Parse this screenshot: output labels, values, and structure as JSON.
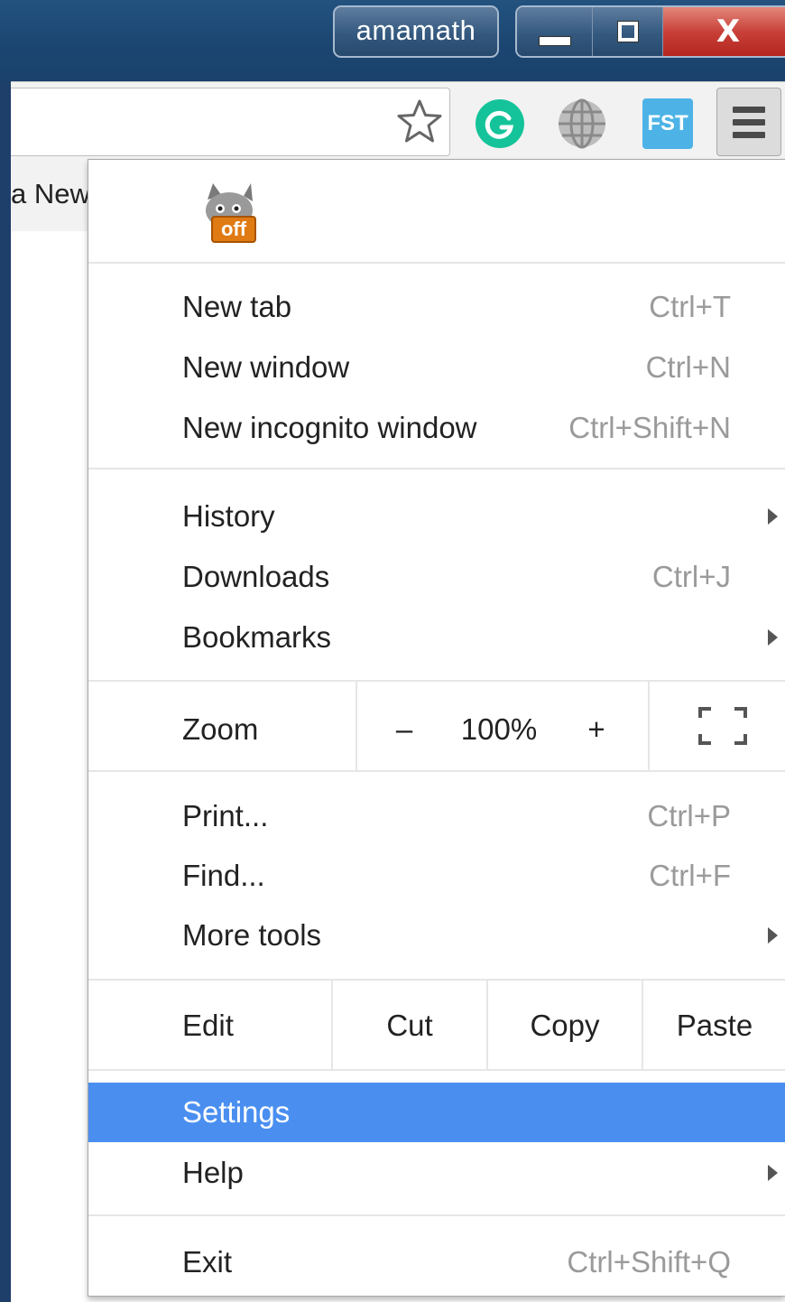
{
  "titlebar": {
    "user_label": "amamath",
    "minimize_icon": "minimize-icon",
    "maximize_icon": "restore-icon",
    "close_label": "X"
  },
  "toolbar": {
    "bookmark_icon": "star-icon",
    "extensions": [
      "grammarly-icon",
      "globe-icon",
      "fst-icon"
    ],
    "fst_label": "FST",
    "menu_icon": "hamburger-icon"
  },
  "page": {
    "tab_partial_text": "a New"
  },
  "menu": {
    "extension_badge": "off",
    "group1": [
      {
        "label": "New tab",
        "shortcut": "Ctrl+T"
      },
      {
        "label": "New window",
        "shortcut": "Ctrl+N"
      },
      {
        "label": "New incognito window",
        "shortcut": "Ctrl+Shift+N"
      }
    ],
    "group2": [
      {
        "label": "History",
        "shortcut": "",
        "submenu": true
      },
      {
        "label": "Downloads",
        "shortcut": "Ctrl+J"
      },
      {
        "label": "Bookmarks",
        "shortcut": "",
        "submenu": true
      }
    ],
    "zoom": {
      "label": "Zoom",
      "minus": "–",
      "value": "100%",
      "plus": "+",
      "fullscreen_icon": "fullscreen-icon"
    },
    "group3": [
      {
        "label": "Print...",
        "shortcut": "Ctrl+P"
      },
      {
        "label": "Find...",
        "shortcut": "Ctrl+F"
      },
      {
        "label": "More tools",
        "shortcut": "",
        "submenu": true
      }
    ],
    "edit": {
      "label": "Edit",
      "cut": "Cut",
      "copy": "Copy",
      "paste": "Paste"
    },
    "group4": [
      {
        "label": "Settings",
        "shortcut": "",
        "highlighted": true
      },
      {
        "label": "Help",
        "shortcut": "",
        "submenu": true
      }
    ],
    "exit": {
      "label": "Exit",
      "shortcut": "Ctrl+Shift+Q"
    },
    "highlight_color": "#4a8ff0"
  }
}
